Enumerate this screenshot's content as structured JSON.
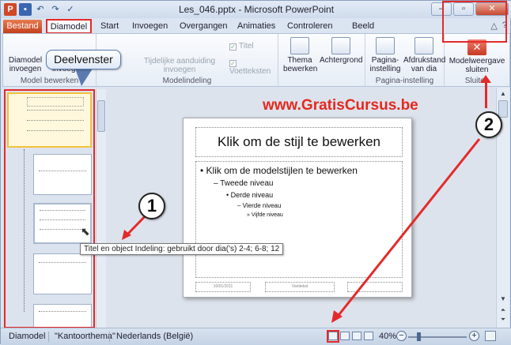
{
  "window": {
    "title": "Les_046.pptx - Microsoft PowerPoint",
    "app_icon": "P",
    "controls": {
      "minimize": "–",
      "maximize": "▫",
      "close": "✕"
    }
  },
  "tabs": [
    {
      "label": "Bestand"
    },
    {
      "label": "Diamodel"
    },
    {
      "label": "Start"
    },
    {
      "label": "Invoegen"
    },
    {
      "label": "Overgangen"
    },
    {
      "label": "Animaties"
    },
    {
      "label": "Controleren"
    },
    {
      "label": "Beeld"
    }
  ],
  "ribbon": {
    "groups": {
      "model_bewerken": "Model bewerken",
      "modelindeling": "Modelindeling",
      "pagina_instelling": "Pagina-instelling",
      "sluiten": "Sluiten"
    },
    "buttons": {
      "diamodel_invoegen": "Diamodel invoegen",
      "indeling_invoegen": "invoegen",
      "tijdelijke": "Tijdelijke aanduiding invoegen",
      "titel": "Titel",
      "voetteksten": "Voetteksten",
      "thema": "Thema bewerken",
      "achtergrond": "Achtergrond",
      "pagina_instelling": "Pagina-instelling",
      "afdrukstand": "Afdrukstand van dia",
      "modelweergave": "Modelweergave sluiten"
    }
  },
  "callout": {
    "text": "Deelvenster"
  },
  "watermark": {
    "text": "www.GratisCursus.be"
  },
  "badges": {
    "one": "1",
    "two": "2"
  },
  "thumbnails": {
    "first_number": "1"
  },
  "slide": {
    "title": "Klik om de stijl te bewerken",
    "levels": [
      "Klik om de modelstijlen te bewerken",
      "Tweede niveau",
      "Derde niveau",
      "Vierde niveau",
      "Vijfde niveau"
    ],
    "footer_date": "10/01/2011",
    "footer_text": "Voettekst"
  },
  "tooltip": {
    "text": "Titel en object Indeling: gebruikt door dia('s) 2-4; 6-8; 12"
  },
  "statusbar": {
    "view": "Diamodel",
    "theme": "\"Kantoorthema\"",
    "language": "Nederlands (België)",
    "zoom": "40%"
  },
  "colors": {
    "accent_red": "#e32a2a",
    "file_tab": "#d24726",
    "watermark": "#e5281f"
  }
}
